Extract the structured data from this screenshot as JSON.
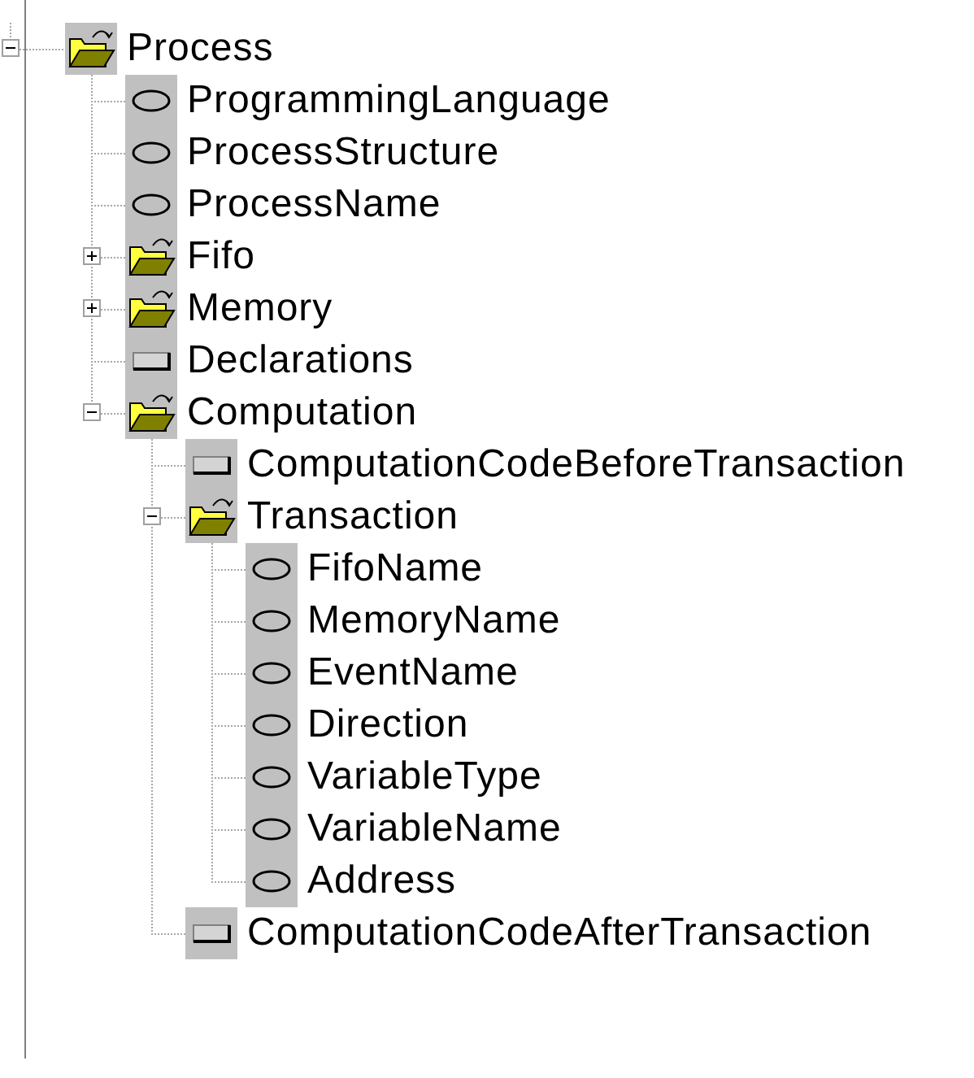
{
  "tree": [
    {
      "label": "Process",
      "kind": "folder",
      "expanded": true,
      "children": [
        {
          "label": "ProgrammingLanguage",
          "kind": "attribute"
        },
        {
          "label": "ProcessStructure",
          "kind": "attribute"
        },
        {
          "label": "ProcessName",
          "kind": "attribute"
        },
        {
          "label": "Fifo",
          "kind": "folder",
          "expanded": false
        },
        {
          "label": "Memory",
          "kind": "folder",
          "expanded": false
        },
        {
          "label": "Declarations",
          "kind": "element"
        },
        {
          "label": "Computation",
          "kind": "folder",
          "expanded": true,
          "children": [
            {
              "label": "ComputationCodeBeforeTransaction",
              "kind": "element"
            },
            {
              "label": "Transaction",
              "kind": "folder",
              "expanded": true,
              "children": [
                {
                  "label": "FifoName",
                  "kind": "attribute"
                },
                {
                  "label": "MemoryName",
                  "kind": "attribute"
                },
                {
                  "label": "EventName",
                  "kind": "attribute"
                },
                {
                  "label": "Direction",
                  "kind": "attribute"
                },
                {
                  "label": "VariableType",
                  "kind": "attribute"
                },
                {
                  "label": "VariableName",
                  "kind": "attribute"
                },
                {
                  "label": "Address",
                  "kind": "attribute"
                }
              ]
            },
            {
              "label": "ComputationCodeAfterTransaction",
              "kind": "element"
            }
          ]
        }
      ]
    }
  ]
}
